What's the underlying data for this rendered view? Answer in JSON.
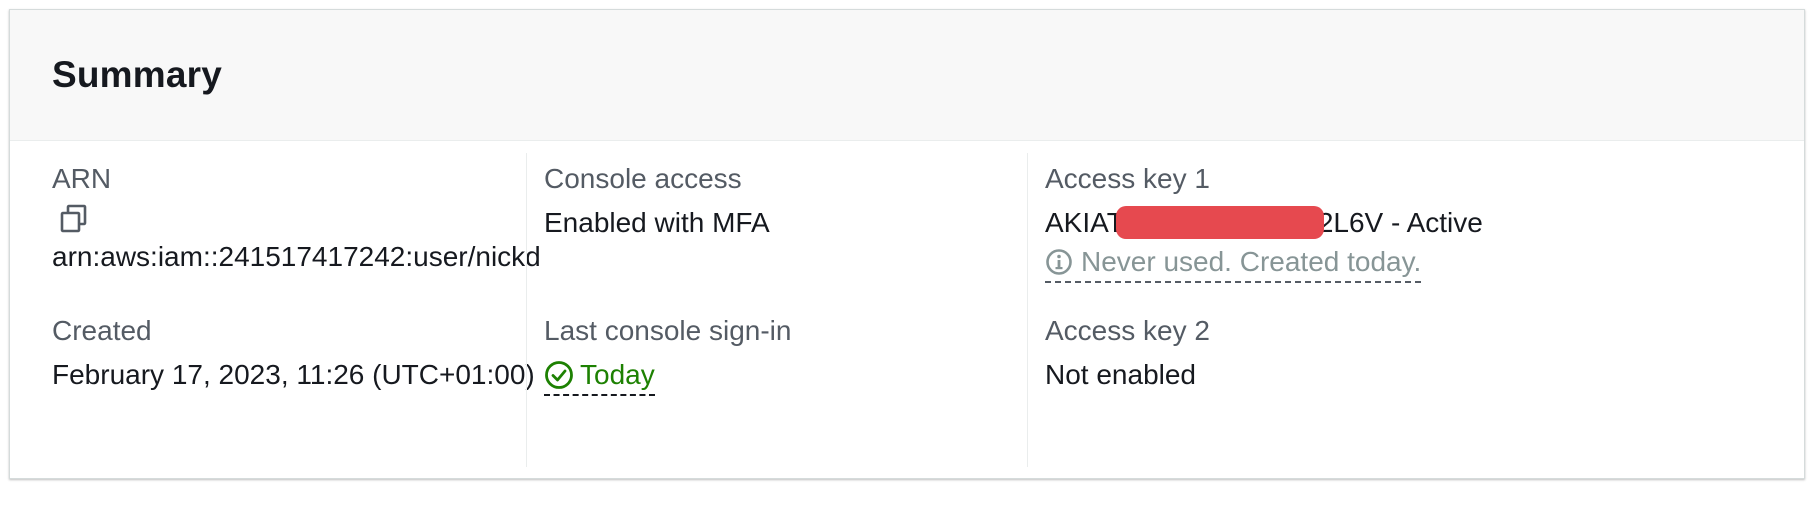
{
  "summary": {
    "title": "Summary",
    "arn": {
      "label": "ARN",
      "value": "arn:aws:iam::241517417242:user/nickd",
      "copy_icon": "copy-icon"
    },
    "created": {
      "label": "Created",
      "value": "February 17, 2023, 11:26 (UTC+01:00)"
    },
    "console_access": {
      "label": "Console access",
      "value": "Enabled with MFA"
    },
    "last_sign_in": {
      "label": "Last console sign-in",
      "value": "Today",
      "icon": "check-circle-icon",
      "color": "#1d8102"
    },
    "access_key_1": {
      "label": "Access key 1",
      "value_prefix": "AKIAT",
      "value_suffix": "2L6V - Active",
      "info_icon": "info-icon",
      "info_text": "Never used. Created today.",
      "redaction_color": "#e6494f"
    },
    "access_key_2": {
      "label": "Access key 2",
      "value": "Not enabled"
    }
  }
}
